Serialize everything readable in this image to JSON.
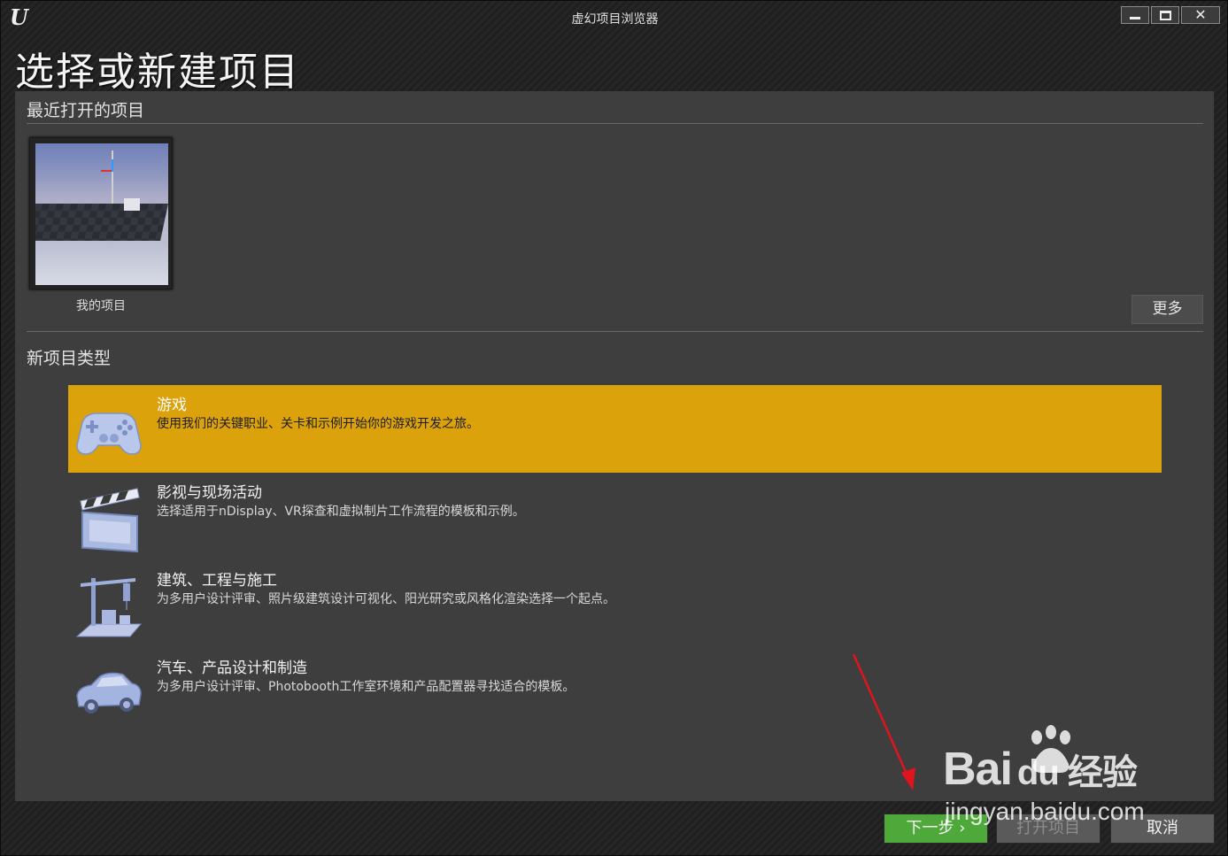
{
  "window": {
    "title": "虚幻项目浏览器",
    "logo_text": "U"
  },
  "page": {
    "title": "选择或新建项目"
  },
  "recent": {
    "header": "最近打开的项目",
    "projects": [
      {
        "label": "我的项目"
      }
    ],
    "more_label": "更多"
  },
  "new_project": {
    "header": "新项目类型",
    "categories": [
      {
        "name": "游戏",
        "desc": "使用我们的关键职业、关卡和示例开始你的游戏开发之旅。",
        "icon": "gamepad-icon",
        "selected": true
      },
      {
        "name": "影视与现场活动",
        "desc": "选择适用于nDisplay、VR探查和虚拟制片工作流程的模板和示例。",
        "icon": "clapperboard-icon",
        "selected": false
      },
      {
        "name": "建筑、工程与施工",
        "desc": "为多用户设计评审、照片级建筑设计可视化、阳光研究或风格化渲染选择一个起点。",
        "icon": "crane-icon",
        "selected": false
      },
      {
        "name": "汽车、产品设计和制造",
        "desc": "为多用户设计评审、Photobooth工作室环境和产品配置器寻找适合的模板。",
        "icon": "car-icon",
        "selected": false
      }
    ]
  },
  "buttons": {
    "next": "下一步 ›",
    "open": "打开项目",
    "cancel": "取消"
  },
  "watermark": {
    "brand": "Bai",
    "brand_suffix": "du 经验",
    "url": "jingyan.baidu.com"
  },
  "colors": {
    "selected_category": "#dca20c",
    "next_button": "#4ea83a",
    "annotation_arrow": "#e0141e"
  }
}
